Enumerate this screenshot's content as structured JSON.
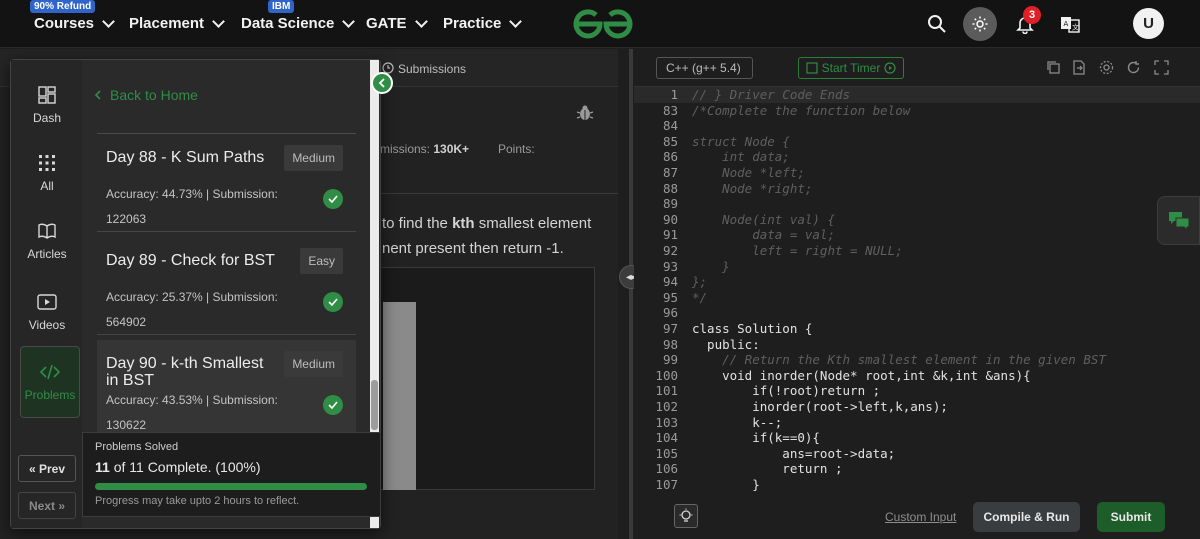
{
  "nav": {
    "courses_badge": "90% Refund",
    "courses": "Courses",
    "placement": "Placement",
    "data_science_badge": "IBM",
    "data_science": "Data Science",
    "gate": "GATE",
    "practice": "Practice",
    "notification_count": "3",
    "avatar_initial": "U"
  },
  "problem": {
    "tab_submissions": "Submissions",
    "stat_submissions_label": "missions:",
    "stat_submissions_value": "130K+",
    "stat_points_label": "Points:",
    "desc_line1_pre": "to find the ",
    "desc_line1_bold": "kth",
    "desc_line1_post": " smallest element",
    "desc_line2": "nent present then return -1."
  },
  "drawer": {
    "sidebar": {
      "dash": "Dash",
      "all": "All",
      "articles": "Articles",
      "videos": "Videos",
      "problems": "Problems",
      "prev": "Prev",
      "next": "Next"
    },
    "back_home": "Back to Home",
    "problems": [
      {
        "title": "Day 88 - K Sum Paths",
        "difficulty": "Medium",
        "accuracy": "Accuracy: 44.73% | Submission:",
        "submissions": "122063",
        "solved": true
      },
      {
        "title": "Day 89 - Check for BST",
        "difficulty": "Easy",
        "accuracy": "Accuracy: 25.37% | Submission:",
        "submissions": "564902",
        "solved": true
      },
      {
        "title": "Day 90 - k-th Smallest in BST",
        "difficulty": "Medium",
        "accuracy": "Accuracy: 43.53% | Submission:",
        "submissions": "130622",
        "solved": true
      }
    ],
    "progress": {
      "label": "Problems Solved",
      "count_bold": "11",
      "count_text": " of 11 Complete. (100%)",
      "fraction": 1.0,
      "note": "Progress may take upto 2 hours to reflect."
    }
  },
  "editor": {
    "language": "C++ (g++ 5.4)",
    "start_timer": "Start Timer",
    "custom_input": "Custom Input",
    "compile_run": "Compile & Run",
    "submit": "Submit",
    "lines": [
      {
        "no": "1",
        "text": "// } Driver Code Ends",
        "kind": "comment"
      },
      {
        "no": "83",
        "text": "/*Complete the function below",
        "kind": "comment"
      },
      {
        "no": "84",
        "text": "",
        "kind": "code"
      },
      {
        "no": "85",
        "text": "struct Node {",
        "kind": "comment"
      },
      {
        "no": "86",
        "text": "    int data;",
        "kind": "comment"
      },
      {
        "no": "87",
        "text": "    Node *left;",
        "kind": "comment"
      },
      {
        "no": "88",
        "text": "    Node *right;",
        "kind": "comment"
      },
      {
        "no": "89",
        "text": "",
        "kind": "code"
      },
      {
        "no": "90",
        "text": "    Node(int val) {",
        "kind": "comment"
      },
      {
        "no": "91",
        "text": "        data = val;",
        "kind": "comment"
      },
      {
        "no": "92",
        "text": "        left = right = NULL;",
        "kind": "comment"
      },
      {
        "no": "93",
        "text": "    }",
        "kind": "comment"
      },
      {
        "no": "94",
        "text": "};",
        "kind": "comment"
      },
      {
        "no": "95",
        "text": "*/",
        "kind": "comment"
      },
      {
        "no": "96",
        "text": "",
        "kind": "code"
      },
      {
        "no": "97",
        "text": "class Solution {",
        "kind": "code"
      },
      {
        "no": "98",
        "text": "  public:",
        "kind": "code"
      },
      {
        "no": "99",
        "text": "    // Return the Kth smallest element in the given BST",
        "kind": "comment"
      },
      {
        "no": "100",
        "text": "    void inorder(Node* root,int &k,int &ans){",
        "kind": "code"
      },
      {
        "no": "101",
        "text": "        if(!root)return ;",
        "kind": "code"
      },
      {
        "no": "102",
        "text": "        inorder(root->left,k,ans);",
        "kind": "code"
      },
      {
        "no": "103",
        "text": "        k--;",
        "kind": "code"
      },
      {
        "no": "104",
        "text": "        if(k==0){",
        "kind": "code"
      },
      {
        "no": "105",
        "text": "            ans=root->data;",
        "kind": "code"
      },
      {
        "no": "106",
        "text": "            return ;",
        "kind": "code"
      },
      {
        "no": "107",
        "text": "        }",
        "kind": "code"
      }
    ]
  },
  "colors": {
    "accent_green": "#2f8d46",
    "notification_red": "#e01f26",
    "badge_blue": "#2f64c8"
  }
}
